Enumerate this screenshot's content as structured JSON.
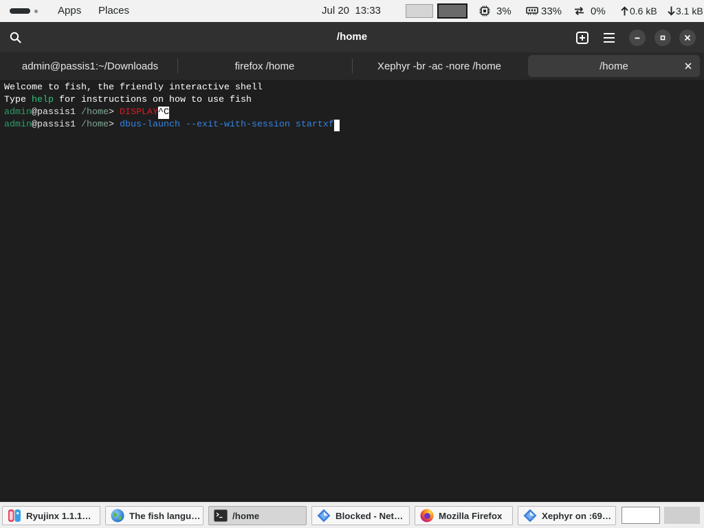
{
  "top_bar": {
    "apps_label": "Apps",
    "places_label": "Places",
    "clock": "Jul 20  13:33",
    "workspaces": [
      {
        "active": false
      },
      {
        "active": true
      }
    ],
    "cpu_usage": "3%",
    "memory_usage": "33%",
    "swap_usage": "0%",
    "upload_rate": "0.6 kB",
    "download_rate": "3.1 kB",
    "icons": [
      "activities-icon",
      "cpu-icon",
      "memory-icon",
      "swap-icon",
      "upload-arrow-icon",
      "download-arrow-icon"
    ]
  },
  "window": {
    "title": "/home",
    "header_icons": [
      "search-icon",
      "new-tab-icon",
      "menu-icon",
      "minimize-icon",
      "maximize-icon",
      "close-icon"
    ],
    "tabs": [
      {
        "label": "admin@passis1:~/Downloads",
        "active": false
      },
      {
        "label": "firefox /home",
        "active": false
      },
      {
        "label": "Xephyr -br -ac -nore /home",
        "active": false
      },
      {
        "label": "/home",
        "active": true
      }
    ]
  },
  "terminal": {
    "background": "#1e1e1e",
    "lines": [
      {
        "segments": [
          {
            "text": "Welcome to fish, the friendly interactive shell",
            "color": "#ffffff"
          }
        ],
        "cursor": false
      },
      {
        "segments": [
          {
            "text": "Type ",
            "color": "#ffffff"
          },
          {
            "text": "help",
            "color": "#2ec27e"
          },
          {
            "text": " for instructions on how to use fish",
            "color": "#ffffff"
          }
        ],
        "cursor": false
      },
      {
        "segments": [
          {
            "text": "admin",
            "color": "#26a269"
          },
          {
            "text": "@passis1 ",
            "color": "#e6e6e6"
          },
          {
            "text": "/home",
            "color": "#7fa893"
          },
          {
            "text": "> ",
            "color": "#e6e6e6"
          },
          {
            "text": "DISPLAY",
            "color": "#e01b24"
          },
          {
            "text": "^C",
            "color": "#000000",
            "background": "#ffffff"
          }
        ],
        "cursor": false
      },
      {
        "segments": [
          {
            "text": "admin",
            "color": "#26a269"
          },
          {
            "text": "@passis1 ",
            "color": "#e6e6e6"
          },
          {
            "text": "/home",
            "color": "#7fa893"
          },
          {
            "text": "> ",
            "color": "#e6e6e6"
          },
          {
            "text": "dbus-launch --exit-with-session startxf",
            "color": "#3584e4"
          }
        ],
        "cursor": true
      }
    ]
  },
  "taskbar": {
    "items": [
      {
        "label": "Ryujinx 1.1.1…",
        "icon": "ryujinx-icon",
        "active": false
      },
      {
        "label": "The fish langu…",
        "icon": "globe-icon",
        "active": false
      },
      {
        "label": "/home",
        "icon": "terminal-icon",
        "active": true
      },
      {
        "label": "Blocked - Net…",
        "icon": "blue-diamond-icon",
        "active": false
      },
      {
        "label": "Mozilla Firefox",
        "icon": "firefox-icon",
        "active": false
      },
      {
        "label": "Xephyr on :69…",
        "icon": "blue-diamond-icon",
        "active": false
      }
    ],
    "workspaces": [
      {
        "active": true
      },
      {
        "active": false
      }
    ]
  }
}
